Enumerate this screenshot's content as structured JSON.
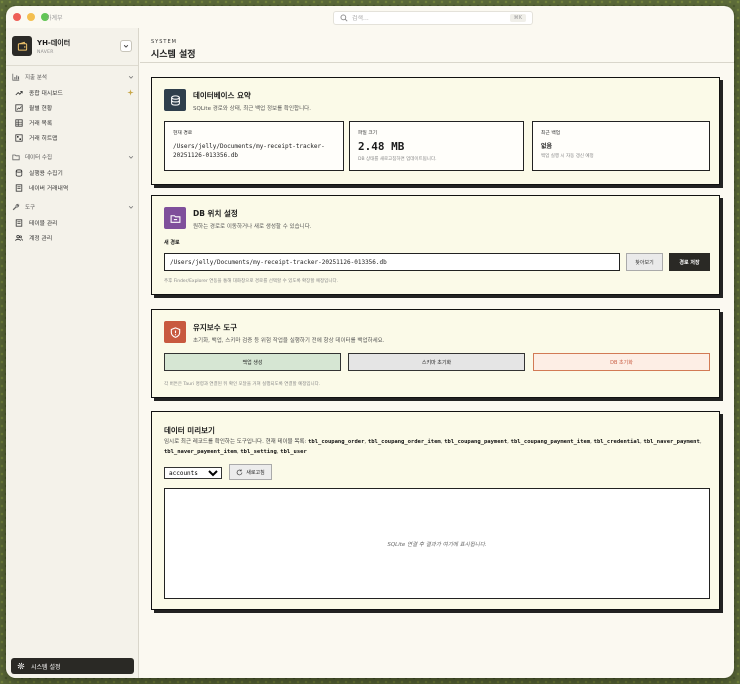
{
  "window": {
    "app_name": "가계부"
  },
  "search": {
    "placeholder": "검색...",
    "shortcut": "⌘K"
  },
  "workspace": {
    "title": "YH-데이터",
    "subtitle": "NAVER"
  },
  "sidebar": {
    "groups": [
      {
        "label": "지출 분석",
        "items": [
          {
            "label": "종합 대시보드"
          },
          {
            "label": "월별 현황"
          },
          {
            "label": "거래 목록"
          },
          {
            "label": "거래 히트맵"
          }
        ]
      },
      {
        "label": "데이터 수집",
        "items": [
          {
            "label": "실행용 수집기"
          },
          {
            "label": "네이버 거래내역"
          }
        ]
      },
      {
        "label": "도구",
        "items": [
          {
            "label": "테이블 관리"
          },
          {
            "label": "계정 관리"
          }
        ]
      }
    ],
    "bottom_label": "시스템 설정"
  },
  "header": {
    "eyebrow": "SYSTEM",
    "title": "시스템 설정"
  },
  "db_summary": {
    "title": "데이터베이스 요약",
    "desc": "SQLite 경로와 상태, 최근 백업 정보를 확인합니다.",
    "path_label": "현재 경로",
    "path_value": "/Users/jelly/Documents/my-receipt-tracker-20251126-013356.db",
    "size_label": "파일 크기",
    "size_value": "2.48 MB",
    "size_note": "DB 상태를 새로고침하면 업데이트됩니다.",
    "backup_label": "최근 백업",
    "backup_value": "없음",
    "backup_note": "백업 실행 시 자동 갱신 예정"
  },
  "db_location": {
    "title": "DB 위치 설정",
    "desc": "원하는 경로로 이동하거나 새로 생성할 수 있습니다.",
    "field_label": "새 경로",
    "field_value": "/Users/jelly/Documents/my-receipt-tracker-20251126-013356.db",
    "browse_label": "찾아보기",
    "save_label": "경로 저장",
    "note": "추후 Finder/Explorer 연동을 통해 대화창으로 경로를 선택할 수 있도록 확장할 예정입니다."
  },
  "maintenance": {
    "title": "유지보수 도구",
    "desc": "초기화, 백업, 스키마 검증 등 위험 작업을 실행하기 전에 항상 데이터를 백업하세요.",
    "backup_label": "백업 생성",
    "schema_label": "스키마 초기화",
    "reset_label": "DB 초기화",
    "note": "각 버튼은 Tauri 명령과 연결된 뒤 확인 모달을 거쳐 실행되도록 연결할 예정입니다."
  },
  "preview": {
    "title": "데이터 미리보기",
    "desc_prefix": "임시로 최근 레코드를 확인하는 도구입니다. 현재 테이블 목록:",
    "tables": [
      "tbl_coupang_order",
      "tbl_coupang_order_item",
      "tbl_coupang_payment",
      "tbl_coupang_payment_item",
      "tbl_credential",
      "tbl_naver_payment",
      "tbl_naver_payment_item",
      "tbl_setting",
      "tbl_user"
    ],
    "selected_table": "accounts",
    "refresh_label": "새로고침",
    "empty_text": "SQLite 연결 후 결과가 여기에 표시됩니다."
  },
  "colors": {
    "accent_dark": "#2a2925",
    "db_icon": "#2f3f4c",
    "location_icon": "#7f4f9b",
    "maintenance_icon": "#c8593f",
    "success": "#d6e6d3",
    "danger": "#fdeee5"
  }
}
